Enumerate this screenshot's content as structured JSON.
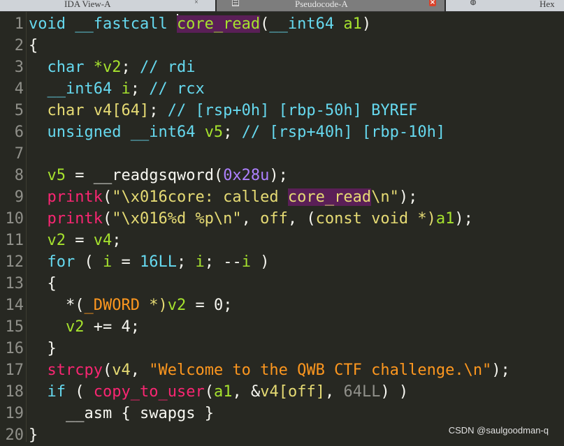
{
  "tabs": [
    {
      "label": "IDA View-A",
      "active": false
    },
    {
      "label": "Pseudocode-A",
      "active": true
    },
    {
      "label": "Hex",
      "active": false
    }
  ],
  "colors": {
    "background": "#272822",
    "line_numbers": "#90908a",
    "keyword": "#66d9ef",
    "function_call": "#f92672",
    "string": "#e6db74",
    "number": "#ae81ff",
    "highlight": "#5a1f57"
  },
  "line_numbers": [
    "1",
    "2",
    "3",
    "4",
    "5",
    "6",
    "7",
    "8",
    "9",
    "10",
    "11",
    "12",
    "13",
    "14",
    "15",
    "16",
    "17",
    "18",
    "19",
    "20"
  ],
  "code": {
    "l1": {
      "void": "void",
      "fastcall": "__fastcall",
      "name": "core_read",
      "open": "(",
      "int64": "__int64",
      "a1": "a1",
      "close": ")"
    },
    "l2": {
      "brace": "{"
    },
    "l3": {
      "char": "char",
      "var": "*v2",
      "semi": ";",
      "comment": "// rdi"
    },
    "l4": {
      "int64": "__int64",
      "var": "i",
      "semi": ";",
      "comment": "// rcx"
    },
    "l5": {
      "decl": "char v4[64]",
      "semi": ";",
      "comment": "// [rsp+0h] [rbp-50h] BYREF"
    },
    "l6": {
      "unsigned": "unsigned",
      "int64": "__int64",
      "var": "v5",
      "semi": ";",
      "comment": "// [rsp+40h] [rbp-10h]"
    },
    "l8": {
      "lhs": "v5",
      "eq": " = ",
      "fn": "__readgsqword",
      "open": "(",
      "arg": "0x28u",
      "close": ");"
    },
    "l9": {
      "fn": "printk",
      "open": "(",
      "str_a": "\"\\x016core: called ",
      "str_hl": "core_read",
      "str_b": "\\n\"",
      "close": ");"
    },
    "l10": {
      "fn": "printk",
      "open": "(",
      "str": "\"\\x016%d %p\\n\"",
      "comma": ", ",
      "off": "off",
      "comma2": ", (",
      "const": "const",
      "void": "void",
      "star": " *)",
      "a1": "a1",
      "close": ");"
    },
    "l11": {
      "lhs": "v2",
      "eq": " = ",
      "rhs": "v4",
      "semi": ";"
    },
    "l12": {
      "for": "for",
      "open": " ( ",
      "i1": "i",
      "eq": " = ",
      "num": "16LL",
      "sep1": "; ",
      "i2": "i",
      "sep2": "; --",
      "i3": "i",
      "close": " )"
    },
    "l13": {
      "brace": "{"
    },
    "l14": {
      "pre": "*(",
      "type": "_DWORD",
      "star": " *)",
      "var": "v2",
      "eq": " = ",
      "num": "0",
      "semi": ";"
    },
    "l15": {
      "var": "v2",
      "op": " += ",
      "num": "4",
      "semi": ";"
    },
    "l16": {
      "brace": "}"
    },
    "l17": {
      "fn": "strcpy",
      "open": "(",
      "v4": "v4",
      "comma": ", ",
      "str": "\"Welcome to the QWB CTF challenge.\\n\"",
      "close": ");"
    },
    "l18": {
      "if": "if",
      "open": " ( ",
      "fn": "copy_to_user",
      "p": "(",
      "a1": "a1",
      "comma": ", &",
      "v4": "v4",
      "br": "[",
      "off": "off",
      "br2": "]",
      "comma2": ", ",
      "num": "64LL",
      "close": ") )"
    },
    "l19": {
      "asm": "__asm",
      "rest": " { ",
      "op": "swapgs",
      "end": " }"
    },
    "l20": {
      "brace": "}"
    }
  },
  "watermark": "CSDN @saulgoodman-q"
}
